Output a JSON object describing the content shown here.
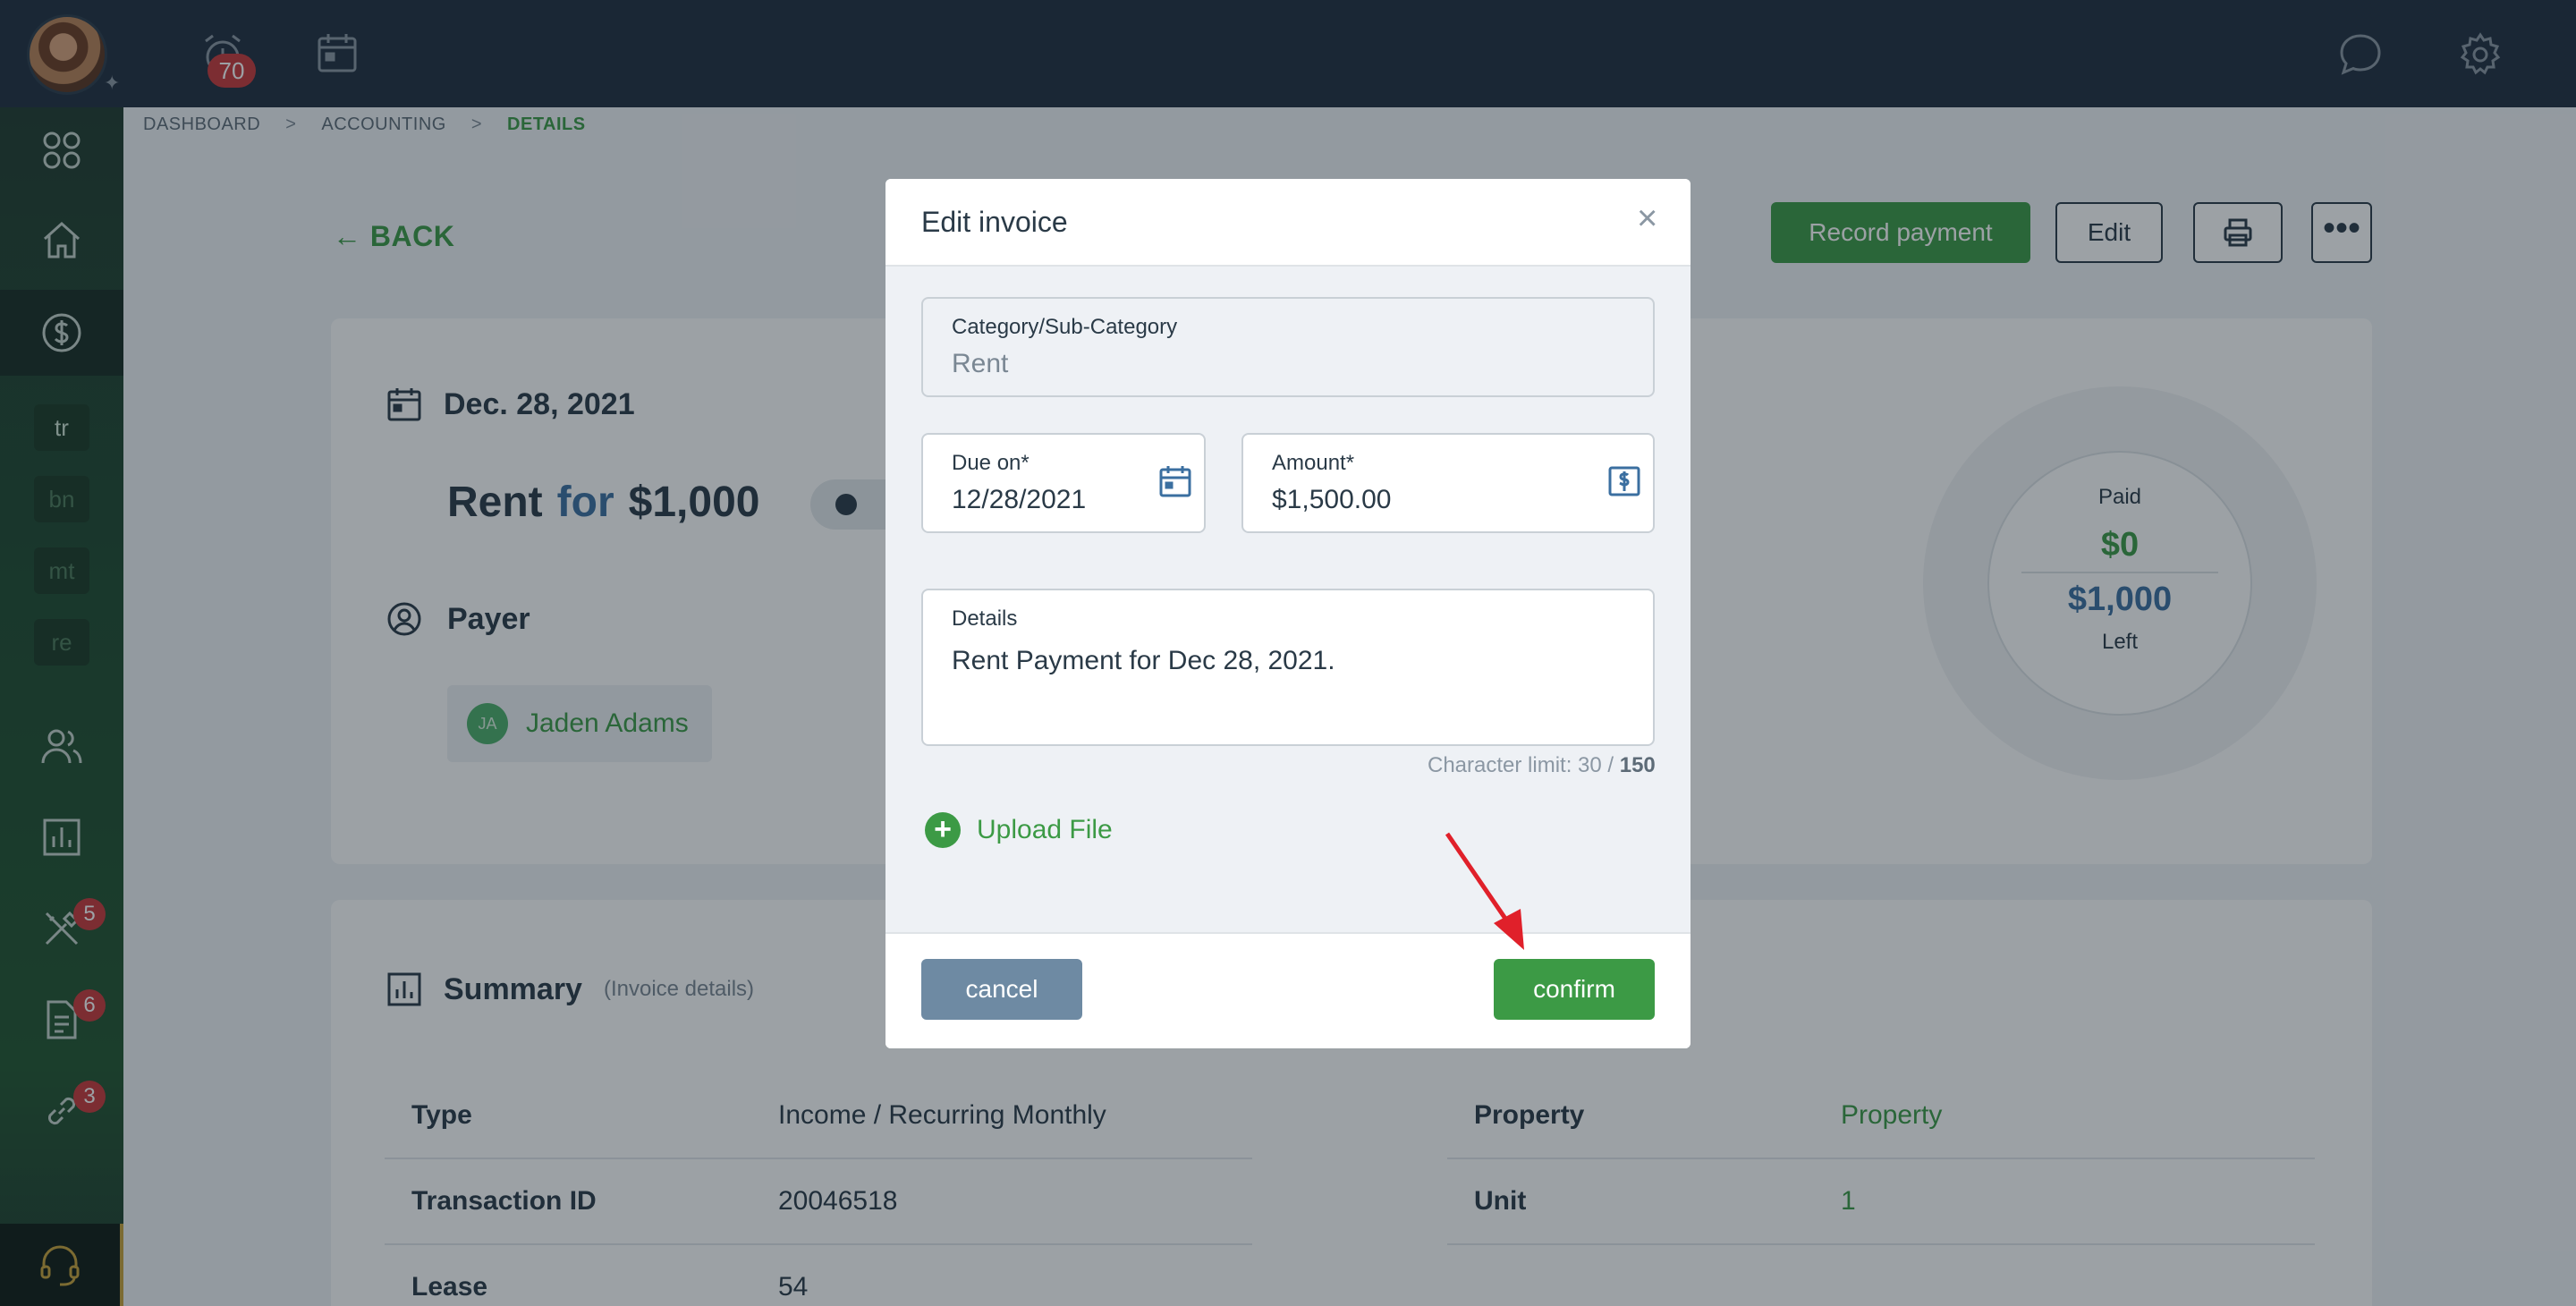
{
  "topbar": {
    "alarm_count": "70"
  },
  "sidebar": {
    "shortcuts": [
      "tr",
      "bn",
      "mt",
      "re"
    ],
    "badges": {
      "maintenance": "5",
      "documents": "6",
      "links": "3"
    }
  },
  "breadcrumb": {
    "items": [
      "DASHBOARD",
      "ACCOUNTING",
      "DETAILS"
    ],
    "separator": ">"
  },
  "page": {
    "back_label": "BACK",
    "actions": {
      "record_payment": "Record payment",
      "edit": "Edit"
    },
    "date": "Dec. 28, 2021",
    "title": {
      "category": "Rent",
      "for": "for",
      "amount": "$1,000"
    },
    "payer_label": "Payer",
    "payer": {
      "initials": "JA",
      "name": "Jaden Adams"
    },
    "balance": {
      "paid_label": "Paid",
      "paid": "$0",
      "left": "$1,000",
      "left_label": "Left"
    },
    "summary": {
      "title": "Summary",
      "subtitle": "(Invoice details)",
      "left_rows": [
        {
          "key": "Type",
          "value": "Income / Recurring Monthly"
        },
        {
          "key": "Transaction ID",
          "value": "20046518"
        },
        {
          "key": "Lease",
          "value": "54"
        }
      ],
      "right_rows": [
        {
          "key": "Property",
          "value": "Property"
        },
        {
          "key": "Unit",
          "value": "1"
        }
      ]
    }
  },
  "modal": {
    "title": "Edit invoice",
    "category": {
      "label": "Category/Sub-Category",
      "value": "Rent"
    },
    "due_on": {
      "label": "Due on*",
      "value": "12/28/2021"
    },
    "amount": {
      "label": "Amount*",
      "value": "$1,500.00"
    },
    "details": {
      "label": "Details",
      "value": "Rent Payment for Dec 28, 2021."
    },
    "char_limit": {
      "prefix": "Character limit: 30 / ",
      "max": "150"
    },
    "upload_label": "Upload File",
    "cancel_label": "cancel",
    "confirm_label": "confirm"
  },
  "colors": {
    "accent": "#3c9a45",
    "topbar": "#1f2e3e",
    "annotation_arrow": "#e0202a"
  }
}
